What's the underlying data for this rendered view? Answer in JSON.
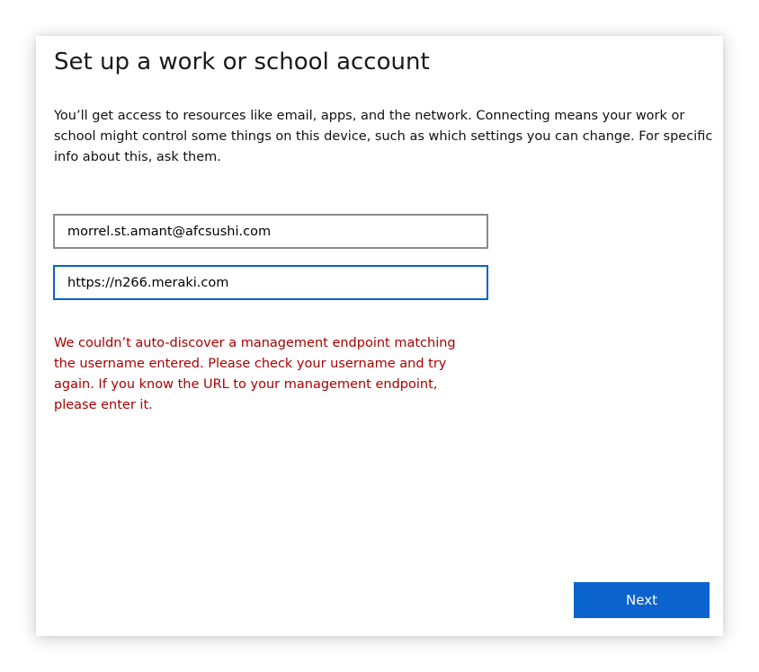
{
  "dialog": {
    "title": "Set up a work or school account",
    "description": "You’ll get access to resources like email, apps, and the network. Connecting means your work or school might control some things on this device, such as which settings you can change. For specific info about this, ask them.",
    "email_field": {
      "value": "morrel.st.amant@afcsushi.com"
    },
    "server_field": {
      "value": "https://n266.meraki.com"
    },
    "error_message": "We couldn’t auto-discover a management endpoint matching the username entered. Please check your username and try again. If you know the URL to your management endpoint, please enter it.",
    "next_label": "Next"
  },
  "colors": {
    "accent": "#0b63ce",
    "focus_border": "#0a62c7",
    "error": "#a80000",
    "field_border": "#8a8a8a"
  }
}
